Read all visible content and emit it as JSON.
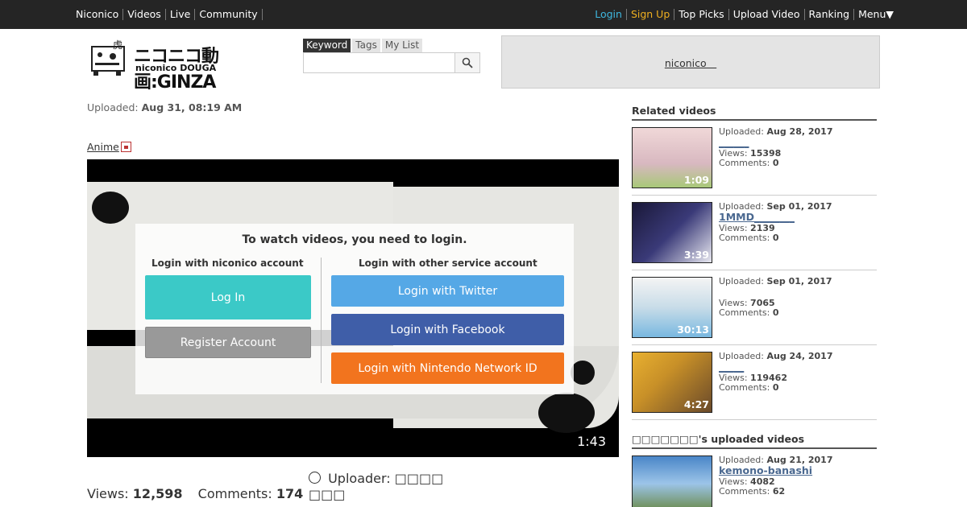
{
  "topbar": {
    "left_links": [
      "Niconico",
      "Videos",
      "Live",
      "Community"
    ],
    "login": "Login",
    "signup": "Sign Up",
    "right_links": [
      "Top Picks",
      "Upload Video",
      "Ranking",
      "Menu▼"
    ]
  },
  "header": {
    "logo_text": "ニコニコ動画:GINZA",
    "logo_sub": "niconico DOUGA",
    "search_tabs": [
      "Keyword",
      "Tags",
      "My List"
    ],
    "ad_link": "niconico　"
  },
  "video": {
    "uploaded_label": "Uploaded:",
    "uploaded_value": "Aug 31, 08:19 AM",
    "category": "Anime",
    "duration": "1:43",
    "views_label": "Views:",
    "views": "12,598",
    "comments_label": "Comments:",
    "comments": "174",
    "uploader_label": "Uploader:",
    "uploader_name": "□□□□",
    "uploader_name2": "□□□"
  },
  "login_prompt": {
    "title": "To watch videos, you need to login.",
    "left_heading": "Login with niconico account",
    "right_heading": "Login with other service account",
    "login_button": "Log In",
    "register_button": "Register Account",
    "twitter_button": "Login with Twitter",
    "facebook_button": "Login with Facebook",
    "nintendo_button": "Login with Nintendo Network ID"
  },
  "sidebar": {
    "related_heading": "Related videos",
    "uploads_heading": "□□□□□□□'s uploaded videos",
    "related": [
      {
        "uploaded_label": "Uploaded:",
        "uploaded": "Aug 28, 2017",
        "title": "______",
        "views_label": "Views:",
        "views": "15398",
        "comments_label": "Comments:",
        "comments": "0",
        "duration": "1:09",
        "thumb_color": "#d8b8c0"
      },
      {
        "uploaded_label": "Uploaded:",
        "uploaded": "Sep 01, 2017",
        "title": "1MMD________",
        "views_label": "Views:",
        "views": "2139",
        "comments_label": "Comments:",
        "comments": "0",
        "duration": "3:39",
        "thumb_color": "#26244a"
      },
      {
        "uploaded_label": "Uploaded:",
        "uploaded": "Sep 01, 2017",
        "title": "",
        "views_label": "Views:",
        "views": "7065",
        "comments_label": "Comments:",
        "comments": "0",
        "duration": "30:13",
        "thumb_color": "#c8dce8"
      },
      {
        "uploaded_label": "Uploaded:",
        "uploaded": "Aug 24, 2017",
        "title": "_____",
        "views_label": "Views:",
        "views": "119462",
        "comments_label": "Comments:",
        "comments": "0",
        "duration": "4:27",
        "thumb_color": "#c89028"
      }
    ],
    "uploads": [
      {
        "uploaded_label": "Uploaded:",
        "uploaded": "Aug 21, 2017",
        "title": "kemono-banashi",
        "views_label": "Views:",
        "views": "4082",
        "comments_label": "Comments:",
        "comments": "62",
        "duration": "",
        "thumb_color": "#5a8ec8"
      }
    ]
  }
}
